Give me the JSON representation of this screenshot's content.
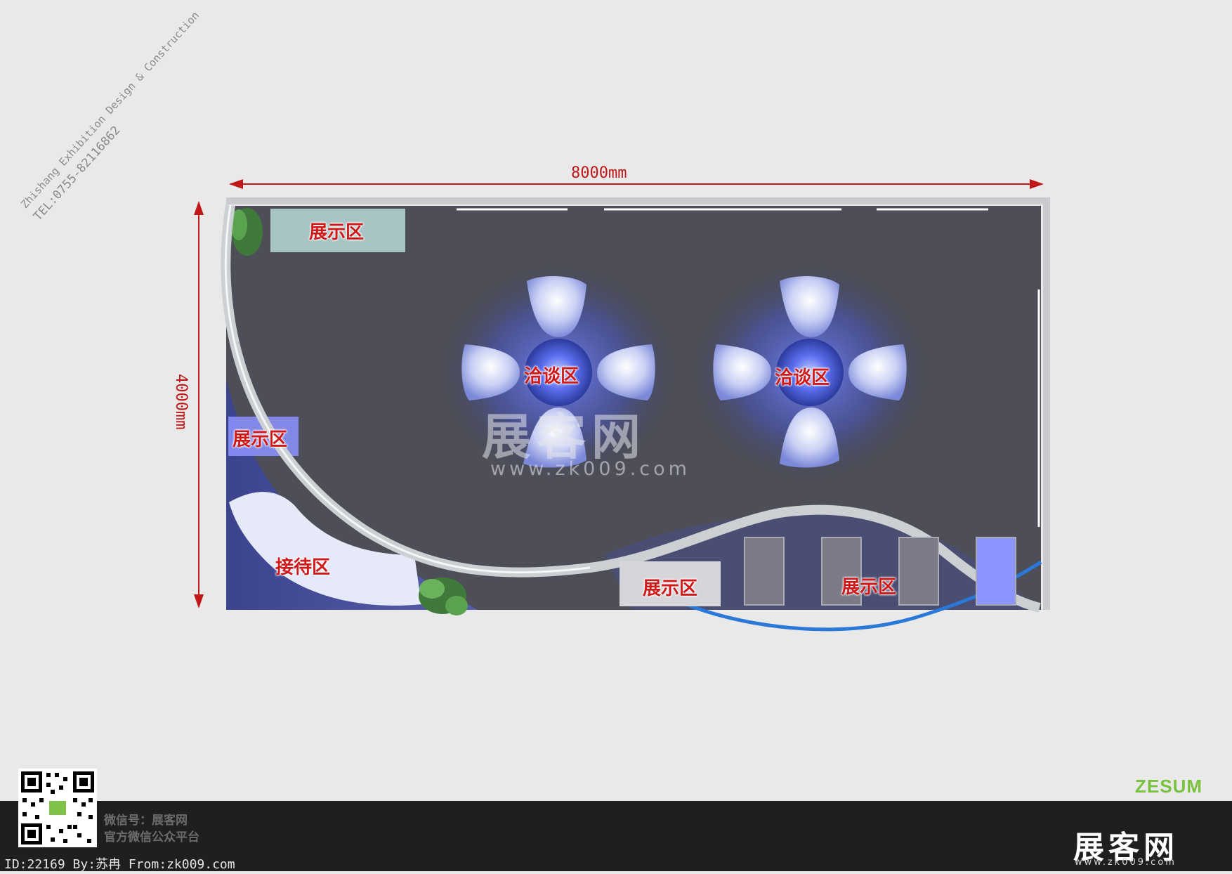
{
  "header": {
    "company_line": "Zhishang Exhibition Design & Construction",
    "tel_line": "TEL:0755-82116862"
  },
  "dimensions": {
    "width_label": "8000mm",
    "height_label": "4000mm"
  },
  "zones": {
    "display_top_left": "展示区",
    "display_left": "展示区",
    "reception": "接待区",
    "negotiation_1": "洽谈区",
    "negotiation_2": "洽谈区",
    "display_bottom_mid": "展示区",
    "display_bottom_right": "展示区"
  },
  "watermark": {
    "title": "展客网",
    "url": "www.zk009.com"
  },
  "footer": {
    "brand_mark": "ZESUM",
    "wechat_id": "微信号：展客网",
    "wechat_desc": "官方微信公众平台",
    "credit": "ID:22169 By:苏冉 From:zk009.com",
    "logo": "展客网",
    "logo_url": "www.zk009.com"
  },
  "colors": {
    "floor": "#4d4e58",
    "dimension": "#c01818",
    "zone_label": "#d01818",
    "accent_blue": "#2a78d8",
    "brand_green": "#79c23d"
  }
}
